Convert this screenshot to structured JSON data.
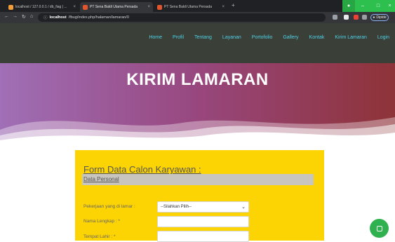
{
  "browser": {
    "tabs": [
      {
        "title": "localhost / 127.0.0.1 / db_fiag | ...",
        "favicon_color": "#f29d38",
        "active": false
      },
      {
        "title": "PT Sena Baldi Utama Persada",
        "favicon_color": "#e2552f",
        "active": true
      },
      {
        "title": "PT Sena Baldi Utama Persada",
        "favicon_color": "#e2552f",
        "active": false
      }
    ],
    "new_tab": "+",
    "url_host": "localhost",
    "url_path": "/fbug/index.php/halaman/lamaran/0",
    "profile_label": "Dipide",
    "controls": {
      "minimize": "–",
      "maximize": "□",
      "close": "×"
    }
  },
  "nav": {
    "links": [
      "Home",
      "Profil",
      "Tentang",
      "Layanan",
      "Portofolio",
      "Gallery",
      "Kontak",
      "Kirim Lamaran",
      "Login"
    ],
    "link_color": "#4fd0e6",
    "background": "#3a3f38"
  },
  "hero": {
    "title": "KIRIM LAMARAN"
  },
  "form": {
    "title": "Form Data Calon Karyawan :",
    "section": "Data Personal",
    "fields": [
      {
        "label": "Pekerjaan yang di lamar :",
        "type": "select",
        "value": "--Silahkan Pilih--"
      },
      {
        "label": "Nama Lengkap : *",
        "type": "text",
        "value": ""
      },
      {
        "label": "Tempat Lahir : *",
        "type": "text",
        "value": ""
      }
    ],
    "panel_color": "#fcd303"
  },
  "fab": {
    "icon": "chat-icon",
    "color": "#2fb14f"
  }
}
